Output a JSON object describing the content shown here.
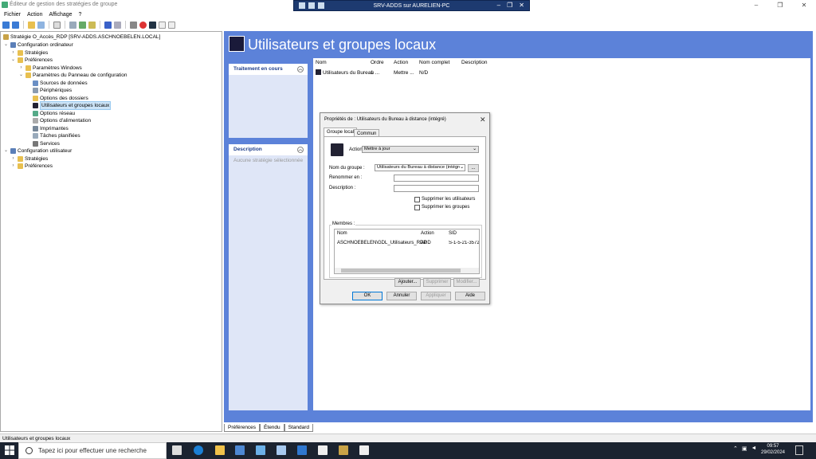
{
  "window": {
    "title": "Éditeur de gestion des stratégies de groupe",
    "controls": [
      "–",
      "❐",
      "✕"
    ]
  },
  "rdp": {
    "title": "SRV-ADDS sur AURELIEN-PC",
    "controls": [
      "–",
      "❐",
      "✕"
    ]
  },
  "menu": [
    "Fichier",
    "Action",
    "Affichage",
    "?"
  ],
  "tree": {
    "root": "Stratégie O_Accès_RDP [SRV-ADDS.ASCHNOEBELEN.LOCAL]",
    "items": [
      "Configuration ordinateur",
      "Stratégies",
      "Préférences",
      "Paramètres Windows",
      "Paramètres du Panneau de configuration",
      "Sources de données",
      "Périphériques",
      "Options des dossiers",
      "Utilisateurs et groupes locaux",
      "Options réseau",
      "Options d'alimentation",
      "Imprimantes",
      "Tâches planifiées",
      "Services",
      "Configuration utilisateur",
      "Stratégies",
      "Préférences"
    ]
  },
  "main": {
    "title": "Utilisateurs et groupes locaux",
    "panel_processing": "Traitement en cours",
    "panel_description": "Description",
    "panel_description_text": "Aucune stratégie sélectionnée",
    "columns": [
      "Nom",
      "Ordre",
      "Action",
      "Nom complet",
      "Description"
    ],
    "row": [
      "Utilisateurs du Bureau ...",
      "1",
      "Mettre ...",
      "N/D",
      ""
    ]
  },
  "tabs": [
    "Préférences",
    "Étendu",
    "Standard"
  ],
  "status": "Utilisateurs et groupes locaux",
  "dialog": {
    "title": "Propriétés de : Utilisateurs du Bureau à distance (intégré)",
    "close": "✕",
    "tab_local": "Groupe local",
    "tab_common": "Commun",
    "action_label": "Action :",
    "action_value": "Mettre à jour",
    "group_label": "Nom du groupe :",
    "group_value": "Utilisateurs du Bureau à distance (intégré)",
    "browse": "...",
    "rename_label": "Renommer en :",
    "desc_label": "Description :",
    "cb_users": "Supprimer les utilisateurs",
    "cb_groups": "Supprimer les groupes",
    "members_label": "Membres :",
    "members_cols": [
      "Nom",
      "Action",
      "SID"
    ],
    "members_row": [
      "ASCHNOEBELEN\\GDL_Utilisateurs_RDP",
      "ADD",
      "S-1-5-21-35720"
    ],
    "add": "Ajouter...",
    "remove": "Supprimer",
    "modify": "Modifier...",
    "ok": "OK",
    "cancel": "Annuler",
    "apply": "Appliquer",
    "help": "Aide"
  },
  "taskbar": {
    "search_placeholder": "Tapez ici pour effectuer une recherche",
    "time": "09:57",
    "date": "29/02/2024"
  }
}
